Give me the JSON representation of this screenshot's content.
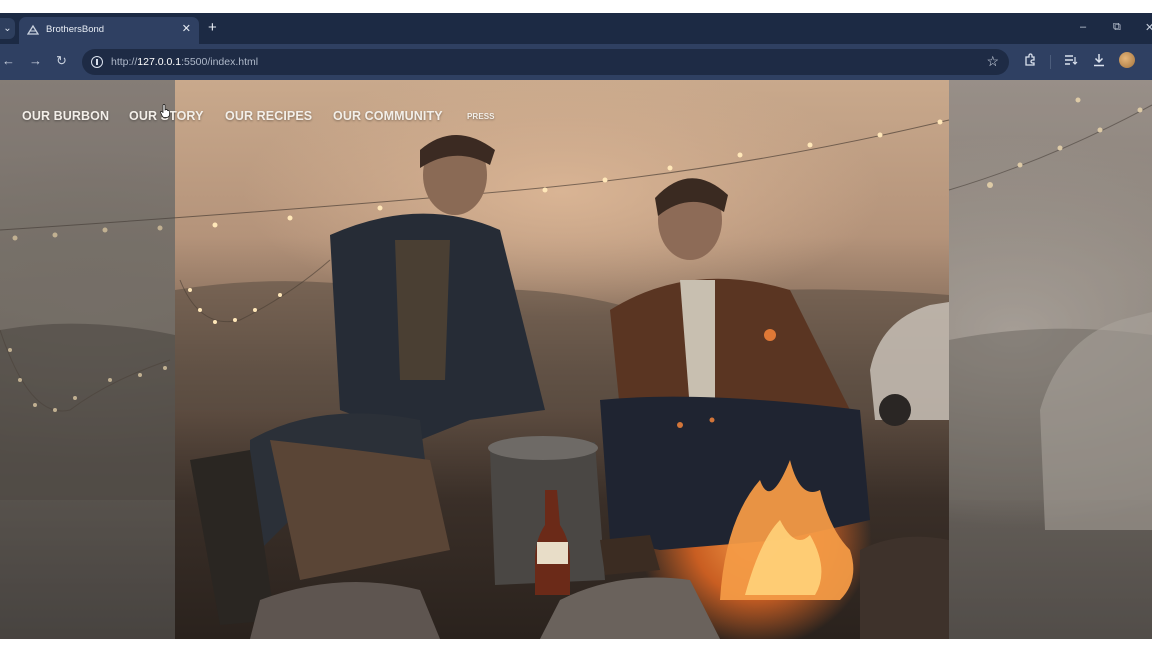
{
  "browser": {
    "tab": {
      "title": "BrothersBond",
      "close_glyph": "✕"
    },
    "new_tab_glyph": "+",
    "window_controls": {
      "minimize": "–",
      "restore": "⧉",
      "close": "✕"
    },
    "toolbar": {
      "url_prefix": "http://",
      "url_host": "127.0.0.1",
      "url_rest": ":5500/index.html",
      "back_glyph": "←",
      "forward_glyph": "→",
      "reload_glyph": "↻",
      "star_glyph": "☆"
    },
    "icons": [
      "tab-search-icon",
      "favicon-icon",
      "info-icon",
      "star-icon",
      "extensions-icon",
      "reading-list-icon",
      "download-icon",
      "profile-icon"
    ]
  },
  "site": {
    "nav": [
      {
        "label": "OUR BURBON"
      },
      {
        "label": "OUR STORY"
      },
      {
        "label": "OUR RECIPES"
      },
      {
        "label": "OUR COMMUNITY"
      },
      {
        "label": "PRESS"
      }
    ]
  },
  "colors": {
    "browser_frame": "#1c2a44",
    "toolbar": "#2f4062",
    "nav_text": "#f3efe9"
  }
}
